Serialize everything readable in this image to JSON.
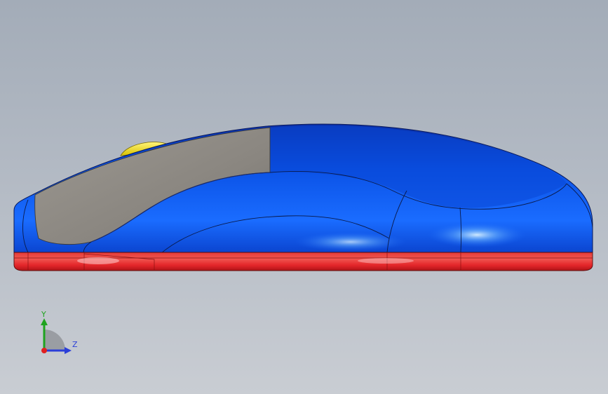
{
  "viewport": {
    "model": "mouse-3d-model"
  },
  "triad": {
    "y_label": "Y",
    "z_label": "Z",
    "colors": {
      "y": "#1fa31f",
      "z": "#2b3fd8",
      "x": "#e02020"
    }
  },
  "colors": {
    "shell_blue": "#0a4fe0",
    "grip_gray": "#8a8680",
    "base_red": "#e8262b",
    "wheel_yellow": "#f2e21a"
  }
}
